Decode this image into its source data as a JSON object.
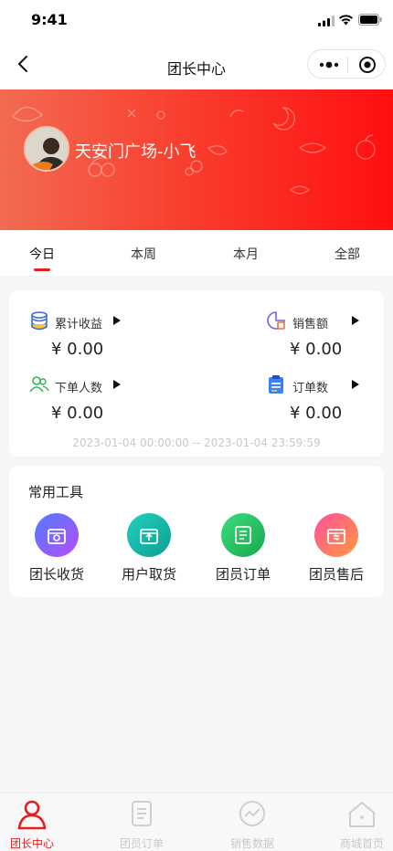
{
  "status_bar": {
    "time": "9:41"
  },
  "navbar": {
    "title": "团长中心"
  },
  "profile": {
    "name": "天安门广场-小飞"
  },
  "tabs": [
    {
      "label": "今日",
      "active": true
    },
    {
      "label": "本周",
      "active": false
    },
    {
      "label": "本月",
      "active": false
    },
    {
      "label": "全部",
      "active": false
    }
  ],
  "stats": {
    "items": [
      {
        "label": "累计收益",
        "value": "¥ 0.00",
        "icon": "coins-stack-icon"
      },
      {
        "label": "销售额",
        "value": "¥ 0.00",
        "icon": "sales-icon"
      },
      {
        "label": "下单人数",
        "value": "¥ 0.00",
        "icon": "users-icon"
      },
      {
        "label": "订单数",
        "value": "¥ 0.00",
        "icon": "clipboard-icon"
      }
    ],
    "range": "2023-01-04 00:00:00 -- 2023-01-04 23:59:59"
  },
  "tools": {
    "heading": "常用工具",
    "items": [
      {
        "label": "团长收货",
        "icon": "receive-box-icon",
        "colors": [
          "#5f6bff",
          "#b54dff"
        ]
      },
      {
        "label": "用户取货",
        "icon": "pickup-box-icon",
        "colors": [
          "#1fc7b7",
          "#11a79b"
        ]
      },
      {
        "label": "团员订单",
        "icon": "order-doc-icon",
        "colors": [
          "#36d070",
          "#1fae55"
        ]
      },
      {
        "label": "团员售后",
        "icon": "aftersale-icon",
        "colors": [
          "#ff5a8c",
          "#ff8a4a"
        ]
      }
    ]
  },
  "tabbar": [
    {
      "label": "团长中心",
      "icon": "leader-icon",
      "active": true
    },
    {
      "label": "团员订单",
      "icon": "order-list-icon",
      "active": false
    },
    {
      "label": "销售数据",
      "icon": "chart-icon",
      "active": false
    },
    {
      "label": "商城首页",
      "icon": "home-icon",
      "active": false
    }
  ],
  "colors": {
    "accent": "#e21f1f",
    "banner_start": "#f26b52",
    "banner_end": "#ff0f0f"
  }
}
